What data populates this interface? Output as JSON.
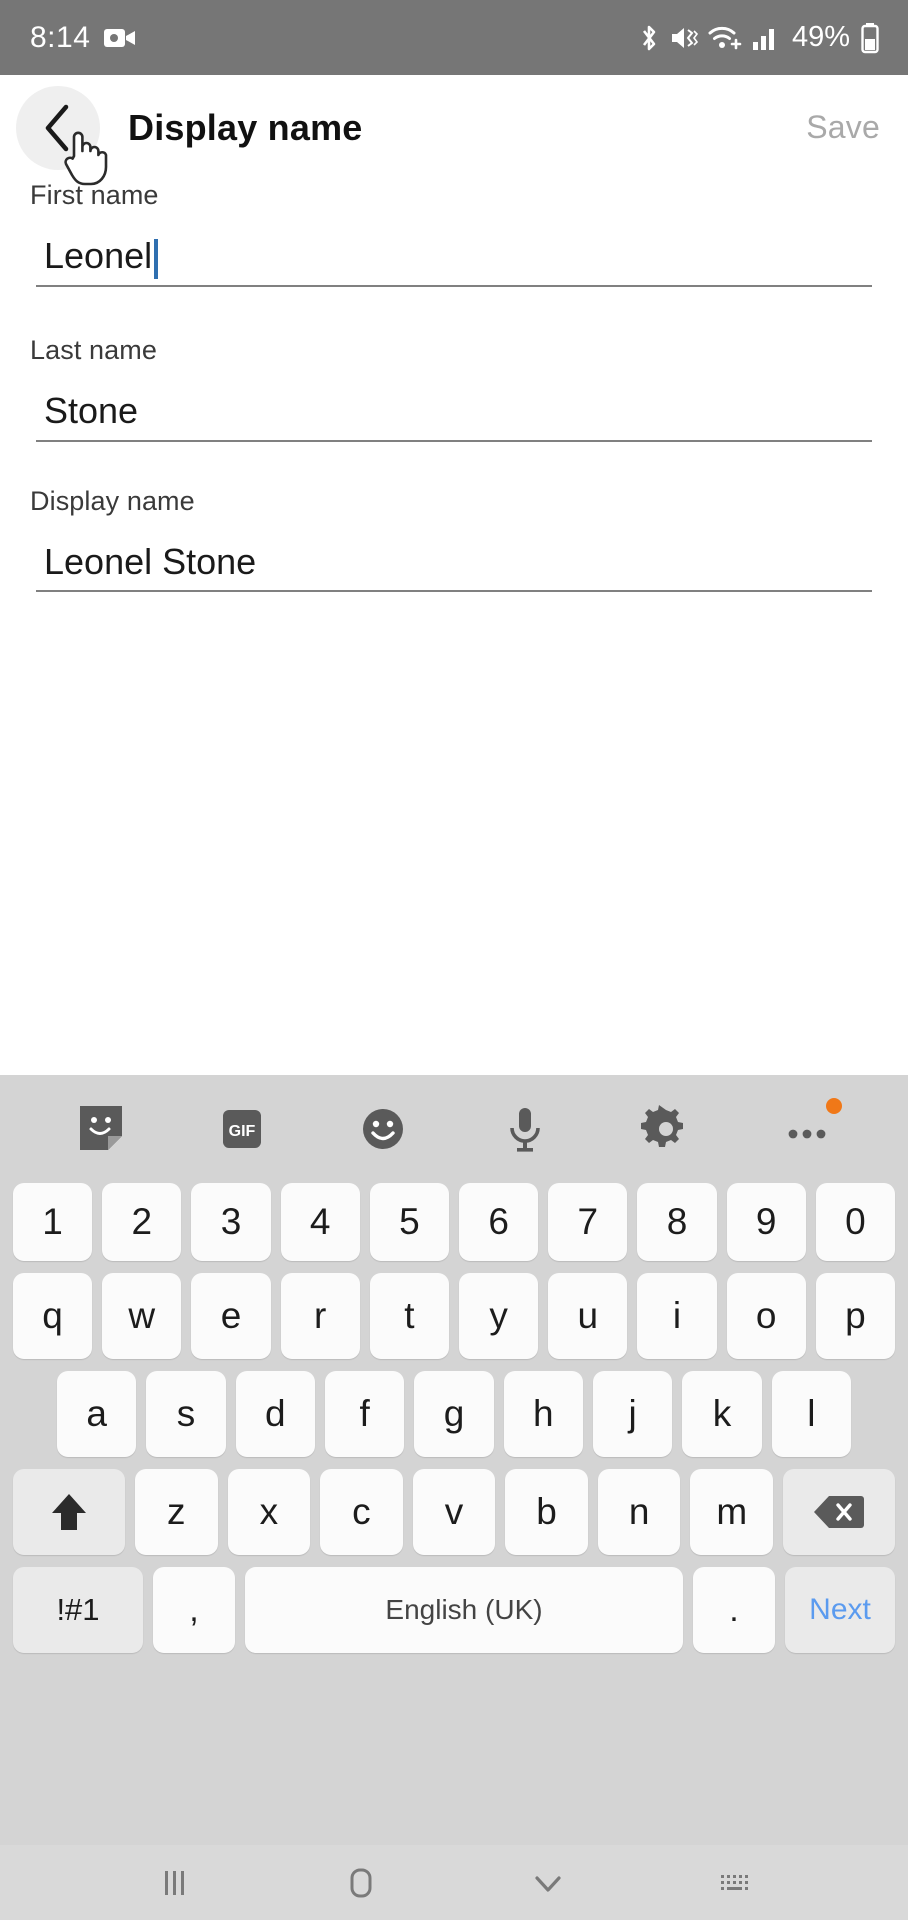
{
  "status_bar": {
    "time": "8:14",
    "battery_percent": "49%",
    "icons": [
      "video-recording-icon",
      "bluetooth-icon",
      "mute-vibrate-icon",
      "wifi-calling-icon",
      "cellular-signal-icon",
      "battery-icon"
    ],
    "background_color": "#767676"
  },
  "app_bar": {
    "back_icon": "chevron-left-icon",
    "title": "Display name",
    "save_label": "Save",
    "save_color": "#a9a9a9",
    "ripple_color": "#efefef"
  },
  "form": {
    "fields": [
      {
        "label": "First name",
        "value": "Leonel",
        "focused": true,
        "caret_color": "#2f6fb0"
      },
      {
        "label": "Last name",
        "value": "Stone",
        "focused": false
      },
      {
        "label": "Display name",
        "value": "Leonel Stone",
        "focused": false
      }
    ]
  },
  "keyboard": {
    "background_color": "#d4d4d4",
    "toolbar": [
      {
        "name": "sticker-icon",
        "label": ""
      },
      {
        "name": "gif-icon",
        "label": "GIF"
      },
      {
        "name": "emoji-icon",
        "label": ""
      },
      {
        "name": "microphone-icon",
        "label": ""
      },
      {
        "name": "settings-gear-icon",
        "label": ""
      },
      {
        "name": "more-options-icon",
        "label": "",
        "badge": true,
        "badge_color": "#f07818"
      }
    ],
    "rows": {
      "numbers": [
        "1",
        "2",
        "3",
        "4",
        "5",
        "6",
        "7",
        "8",
        "9",
        "0"
      ],
      "top": [
        "q",
        "w",
        "e",
        "r",
        "t",
        "y",
        "u",
        "i",
        "o",
        "p"
      ],
      "home": [
        "a",
        "s",
        "d",
        "f",
        "g",
        "h",
        "j",
        "k",
        "l"
      ],
      "bottom": [
        "z",
        "x",
        "c",
        "v",
        "b",
        "n",
        "m"
      ]
    },
    "shift_label": "shift-arrow-icon",
    "backspace_label": "backspace-icon",
    "symbols_key": "!#1",
    "comma_key": ",",
    "space_key": "English (UK)",
    "period_key": ".",
    "action_key": "Next",
    "action_key_color": "#5b9bef"
  },
  "nav_bar": {
    "recents_icon": "recents-icon",
    "home_icon": "home-icon",
    "hide_keyboard_icon": "chevron-down-icon",
    "switch_keyboard_icon": "keyboard-switch-icon"
  }
}
